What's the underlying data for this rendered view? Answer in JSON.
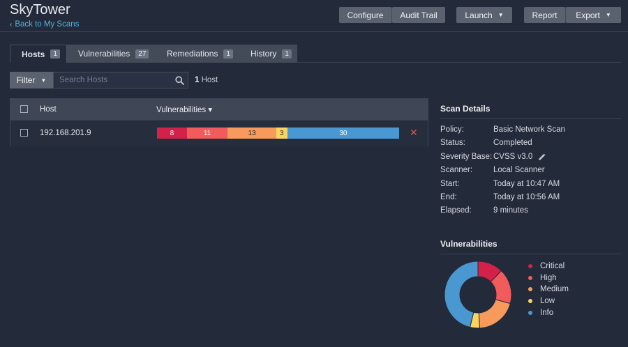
{
  "header": {
    "title": "SkyTower",
    "back_link": "Back to My Scans",
    "buttons": {
      "configure": "Configure",
      "audit_trail": "Audit Trail",
      "launch": "Launch",
      "report": "Report",
      "export": "Export"
    }
  },
  "tabs": [
    {
      "label": "Hosts",
      "count": "1",
      "active": true
    },
    {
      "label": "Vulnerabilities",
      "count": "27",
      "active": false
    },
    {
      "label": "Remediations",
      "count": "1",
      "active": false
    },
    {
      "label": "History",
      "count": "1",
      "active": false
    }
  ],
  "filter": {
    "button_label": "Filter",
    "search_placeholder": "Search Hosts",
    "count_number": "1",
    "count_label": "Host"
  },
  "table": {
    "columns": {
      "host": "Host",
      "vulnerabilities": "Vulnerabilities ▾"
    },
    "rows": [
      {
        "host": "192.168.201.9",
        "segments": [
          {
            "severity": "critical",
            "value": 8
          },
          {
            "severity": "high",
            "value": 11
          },
          {
            "severity": "medium",
            "value": 13
          },
          {
            "severity": "low",
            "value": 3
          },
          {
            "severity": "info",
            "value": 30
          }
        ]
      }
    ]
  },
  "scan_details": {
    "title": "Scan Details",
    "rows": [
      {
        "key": "Policy:",
        "value": "Basic Network Scan"
      },
      {
        "key": "Status:",
        "value": "Completed"
      },
      {
        "key": "Severity Base:",
        "value": "CVSS v3.0"
      },
      {
        "key": "Scanner:",
        "value": "Local Scanner"
      },
      {
        "key": "Start:",
        "value": "Today at 10:47 AM"
      },
      {
        "key": "End:",
        "value": "Today at 10:56 AM"
      },
      {
        "key": "Elapsed:",
        "value": "9 minutes"
      }
    ]
  },
  "vulnerabilities_chart": {
    "title": "Vulnerabilities",
    "legend": [
      {
        "label": "Critical",
        "color": "#d3224a"
      },
      {
        "label": "High",
        "color": "#f15b5b"
      },
      {
        "label": "Medium",
        "color": "#f79a5c"
      },
      {
        "label": "Low",
        "color": "#fbd560"
      },
      {
        "label": "Info",
        "color": "#4a98d1"
      }
    ]
  },
  "colors": {
    "critical": "#d3224a",
    "high": "#f15b5b",
    "medium": "#f79a5c",
    "low": "#fbd560",
    "info": "#4a98d1",
    "link": "#4fb3e0",
    "delete": "#e8504d"
  },
  "icons": {
    "back": "chevron-left-icon",
    "search": "search-icon",
    "edit": "pencil-icon",
    "delete": "close-icon",
    "dropdown": "caret-down-icon"
  }
}
